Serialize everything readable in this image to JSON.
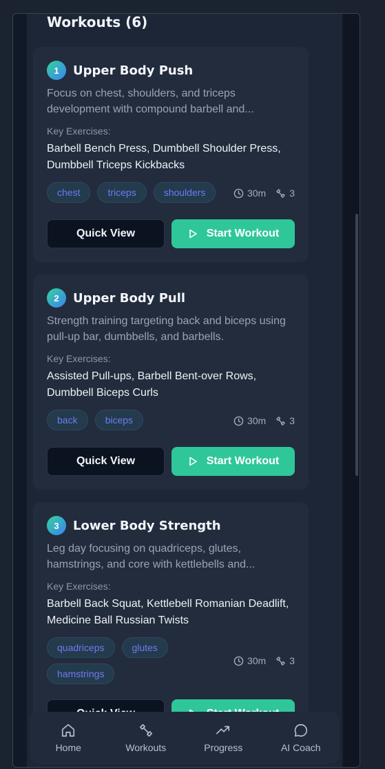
{
  "header": {
    "title": "Workouts (6)"
  },
  "workouts": [
    {
      "number": "1",
      "title": "Upper Body Push",
      "description": "Focus on chest, shoulders, and triceps development with compound barbell and...",
      "key_label": "Key Exercises:",
      "exercises": "Barbell Bench Press, Dumbbell Shoulder Press, Dumbbell Triceps Kickbacks",
      "tags": [
        "chest",
        "triceps",
        "shoulders"
      ],
      "duration": "30m",
      "exercise_count": "3",
      "quick_view_label": "Quick View",
      "start_label": "Start Workout"
    },
    {
      "number": "2",
      "title": "Upper Body Pull",
      "description": "Strength training targeting back and biceps using pull-up bar, dumbbells, and barbells.",
      "key_label": "Key Exercises:",
      "exercises": "Assisted Pull-ups, Barbell Bent-over Rows, Dumbbell Biceps Curls",
      "tags": [
        "back",
        "biceps"
      ],
      "duration": "30m",
      "exercise_count": "3",
      "quick_view_label": "Quick View",
      "start_label": "Start Workout"
    },
    {
      "number": "3",
      "title": "Lower Body Strength",
      "description": "Leg day focusing on quadriceps, glutes, hamstrings, and core with kettlebells and...",
      "key_label": "Key Exercises:",
      "exercises": "Barbell Back Squat, Kettlebell Romanian Deadlift, Medicine Ball Russian Twists",
      "tags": [
        "quadriceps",
        "glutes",
        "hamstrings"
      ],
      "duration": "30m",
      "exercise_count": "3",
      "quick_view_label": "Quick View",
      "start_label": "Start Workout"
    }
  ],
  "nav": {
    "items": [
      {
        "label": "Home",
        "icon": "home-icon"
      },
      {
        "label": "Workouts",
        "icon": "dumbbell-icon"
      },
      {
        "label": "Progress",
        "icon": "trending-up-icon"
      },
      {
        "label": "AI Coach",
        "icon": "chat-bubble-icon"
      }
    ]
  },
  "colors": {
    "accent": "#2fc79a",
    "card": "#222c3d",
    "tag_text": "#6d7cf0"
  }
}
